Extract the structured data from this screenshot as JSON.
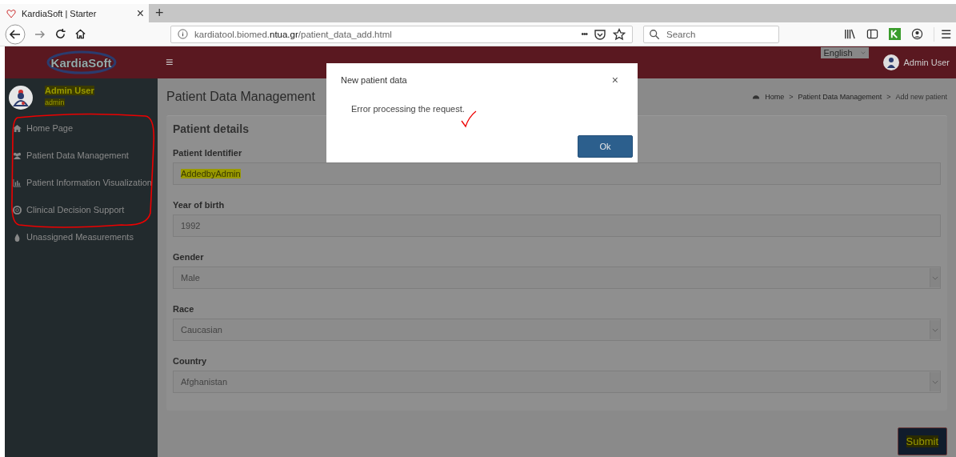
{
  "browser": {
    "tab_title": "KardiaSoft | Starter",
    "tab_close": "×",
    "new_tab": "+",
    "url_prefix": "kardiatool.biomed.",
    "url_domain": "ntua.gr",
    "url_path": "/patient_data_add.html",
    "more": "•••",
    "search_placeholder": "Search",
    "menu": "☰"
  },
  "header": {
    "logo": "KardiaSoft",
    "menu_toggle": "≡",
    "language": "English",
    "user_name": "Admin User"
  },
  "sidebar": {
    "user": {
      "name": "Admin User",
      "role": "admin",
      "highlighted": true
    },
    "items": [
      {
        "label": "Home Page"
      },
      {
        "label": "Patient Data Management"
      },
      {
        "label": "Patient Information Visualization"
      },
      {
        "label": "Clinical Decision Support"
      },
      {
        "label": "Unassigned Measurements"
      }
    ]
  },
  "page": {
    "title": "Patient Data Management",
    "breadcrumb": [
      {
        "label": "Home",
        "separator": ">"
      },
      {
        "label": "Patient Data Management",
        "separator": ">"
      },
      {
        "label": "Add new patient"
      }
    ]
  },
  "form": {
    "title": "Patient details",
    "fields": [
      {
        "label": "Patient Identifier",
        "value": "AddedbyAdmin",
        "kind": "text",
        "highlighted": true
      },
      {
        "label": "Year of birth",
        "value": "1992",
        "kind": "text",
        "highlighted": false
      },
      {
        "label": "Gender",
        "value": "Male",
        "kind": "select",
        "highlighted": false
      },
      {
        "label": "Race",
        "value": "Caucasian",
        "kind": "select",
        "highlighted": false
      },
      {
        "label": "Country",
        "value": "Afghanistan",
        "kind": "select",
        "highlighted": false
      }
    ],
    "submit": {
      "label": "Submit",
      "highlighted": true
    }
  },
  "modal": {
    "title": "New patient data",
    "close": "×",
    "message": "Error processing the request.",
    "button": "Ok"
  }
}
